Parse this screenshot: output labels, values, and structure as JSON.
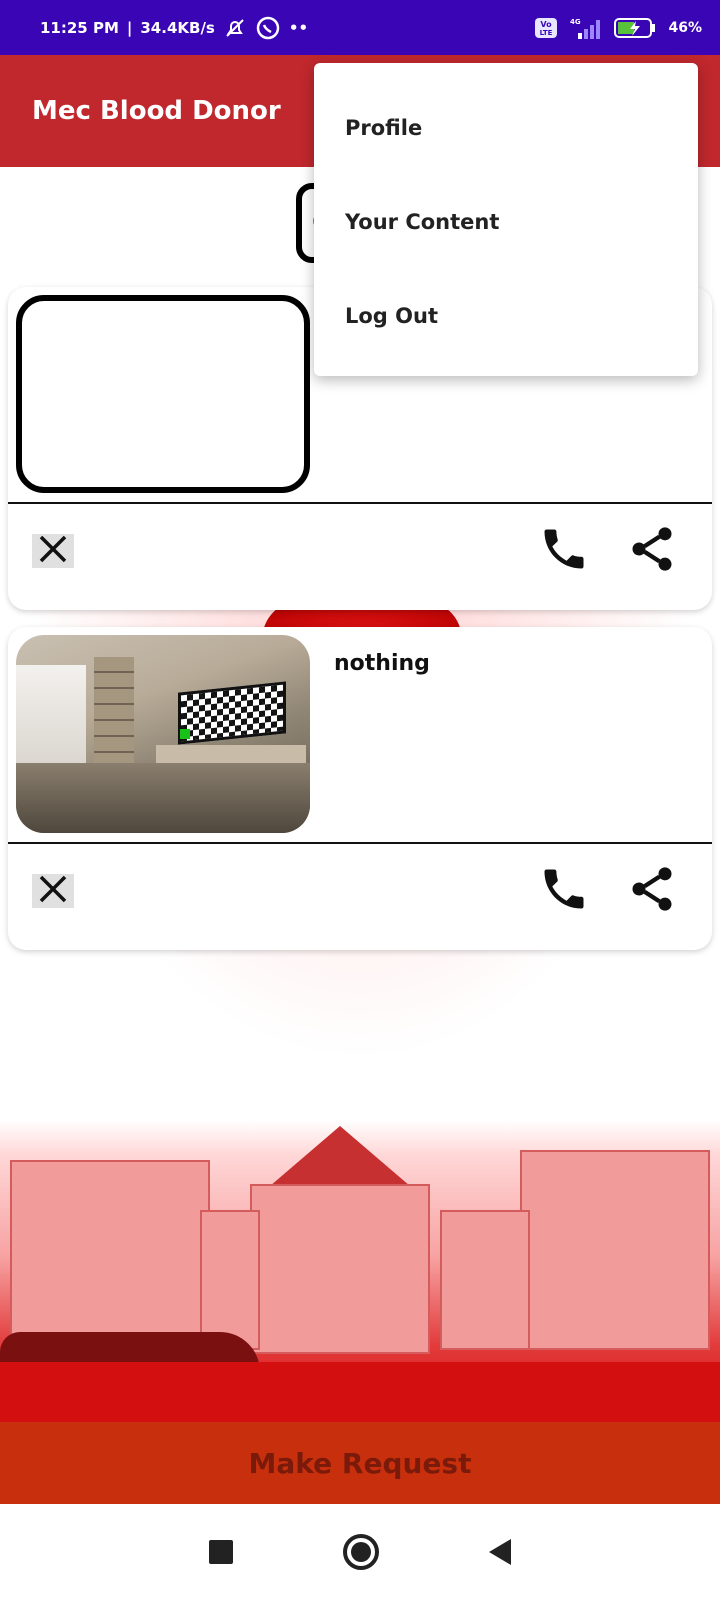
{
  "status_bar": {
    "time": "11:25 PM",
    "speed": "34.4KB/s",
    "volte": "Vo LTE",
    "network": "4G",
    "battery": "46%"
  },
  "app_bar": {
    "title": "Mec Blood Donor"
  },
  "filter": {
    "visible_text": "C"
  },
  "cards": [
    {
      "text": "",
      "has_image": false
    },
    {
      "text": "nothing",
      "has_image": true
    }
  ],
  "menu": {
    "items": [
      {
        "label": "Profile"
      },
      {
        "label": "Your Content"
      },
      {
        "label": "Log Out"
      }
    ]
  },
  "bottom": {
    "make_request_label": "Make Request"
  },
  "colors": {
    "status_bar": "#3a06b5",
    "app_bar": "#c0282d",
    "make_request": "#c8300d"
  },
  "icons": {
    "close": "close-icon",
    "call": "phone-icon",
    "share": "share-icon"
  }
}
